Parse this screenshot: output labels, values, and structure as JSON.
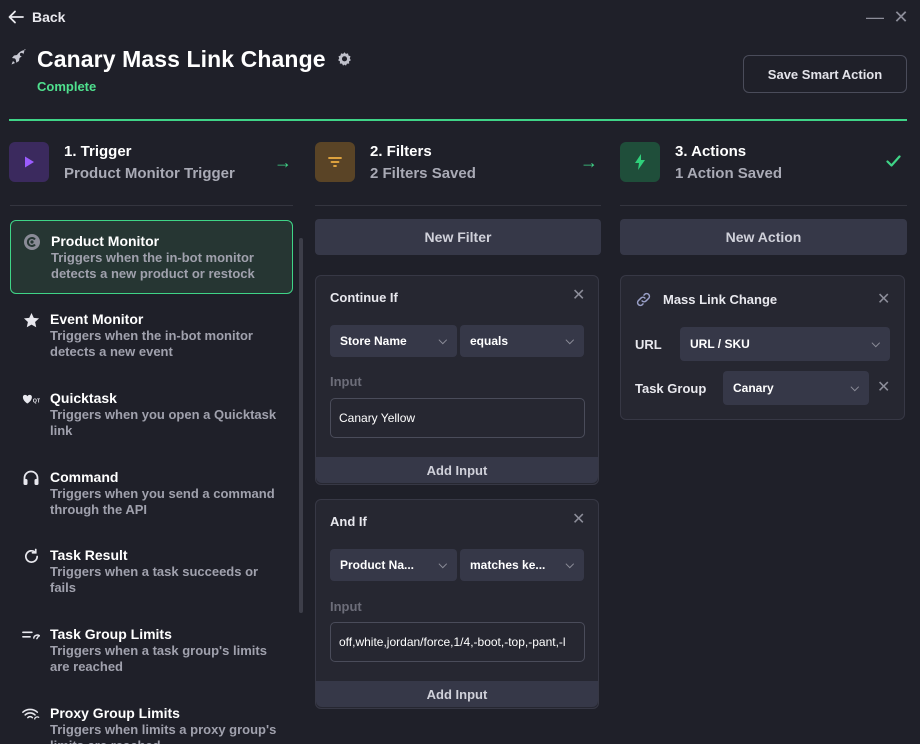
{
  "topbar": {
    "back_label": "Back",
    "minimize": "—",
    "close": "✕"
  },
  "header": {
    "title": "Canary Mass Link Change",
    "status": "Complete",
    "save_label": "Save Smart Action"
  },
  "colors": {
    "accent_green": "#3fd487",
    "trigger_purple": "#8b4df0",
    "filters_amber": "#e0a23a",
    "actions_green": "#2fd07a"
  },
  "steps": [
    {
      "title": "1. Trigger",
      "subtitle": "Product Monitor Trigger",
      "icon": "play-icon"
    },
    {
      "title": "2. Filters",
      "subtitle": "2 Filters Saved",
      "icon": "filter-icon"
    },
    {
      "title": "3. Actions",
      "subtitle": "1 Action Saved",
      "icon": "lightning-icon"
    }
  ],
  "triggers": [
    {
      "title": "Product Monitor",
      "desc": "Triggers when the in-bot monitor detects a new product or restock",
      "icon": "product-monitor-icon"
    },
    {
      "title": "Event Monitor",
      "desc": "Triggers when the in-bot monitor detects a new event",
      "icon": "star-icon"
    },
    {
      "title": "Quicktask",
      "desc": "Triggers when you open a Quicktask link",
      "icon": "quicktask-icon"
    },
    {
      "title": "Command",
      "desc": "Triggers when you send a command through the API",
      "icon": "headset-icon"
    },
    {
      "title": "Task Result",
      "desc": "Triggers when a task succeeds or fails",
      "icon": "refresh-icon"
    },
    {
      "title": "Task Group Limits",
      "desc": "Triggers when a task group's limits are reached",
      "icon": "task-group-limits-icon"
    },
    {
      "title": "Proxy Group Limits",
      "desc": "Triggers when limits a proxy group's limits are reached",
      "icon": "wifi-icon"
    }
  ],
  "filters": {
    "new_label": "New Filter",
    "cards": [
      {
        "heading": "Continue If",
        "field": "Store Name",
        "operator": "equals",
        "input_label": "Input",
        "input_value": "Canary Yellow",
        "add_label": "Add Input"
      },
      {
        "heading": "And If",
        "field": "Product Na...",
        "operator": "matches ke...",
        "input_label": "Input",
        "input_value": "off,white,jordan/force,1/4,-boot,-top,-pant,-l",
        "add_label": "Add Input"
      }
    ]
  },
  "actions": {
    "new_label": "New Action",
    "card": {
      "heading": "Mass Link Change",
      "url_label": "URL",
      "url_value": "URL / SKU",
      "group_label": "Task Group",
      "group_value": "Canary"
    }
  }
}
